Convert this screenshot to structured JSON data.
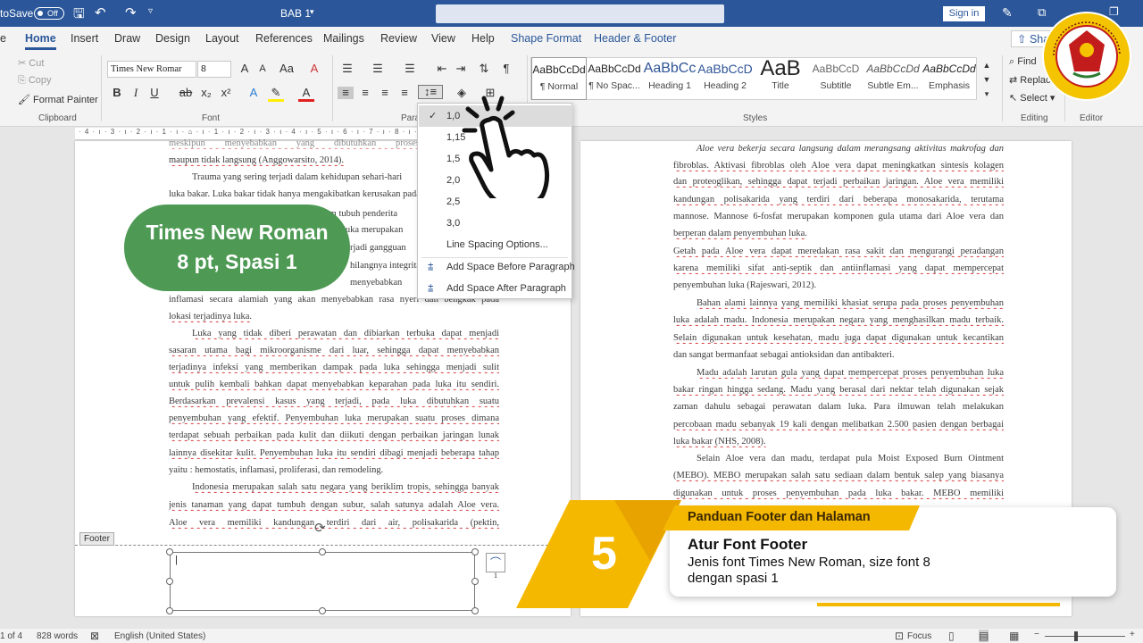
{
  "title_bar": {
    "autosave_label": "toSave",
    "autosave_state": "Off",
    "doc_name": "BAB 1",
    "signin": "Sign in"
  },
  "tabs": [
    "Home",
    "Insert",
    "Draw",
    "Design",
    "Layout",
    "References",
    "Mailings",
    "Review",
    "View",
    "Help",
    "Shape Format",
    "Header & Footer",
    "Shar"
  ],
  "ribbon": {
    "clipboard": {
      "cut": "Cut",
      "copy": "Copy",
      "format_painter": "Format Painter",
      "label": "Clipboard"
    },
    "font": {
      "name": "Times New Romar",
      "size": "8",
      "label": "Font"
    },
    "paragraph": {
      "label": "Para"
    },
    "styles": [
      {
        "preview": "AaBbCcDd",
        "name": "¶ Normal"
      },
      {
        "preview": "AaBbCcDd",
        "name": "¶ No Spac..."
      },
      {
        "preview": "AaBbCc",
        "name": "Heading 1"
      },
      {
        "preview": "AaBbCcD",
        "name": "Heading 2"
      },
      {
        "preview": "AaB",
        "name": "Title"
      },
      {
        "preview": "AaBbCcD",
        "name": "Subtitle"
      },
      {
        "preview": "AaBbCcDd",
        "name": "Subtle Em..."
      },
      {
        "preview": "AaBbCcDd",
        "name": "Emphasis"
      }
    ],
    "styles_label": "Styles",
    "editing": {
      "find": "Find",
      "replace": "Replace",
      "select": "Select",
      "label": "Editing"
    },
    "editor": {
      "label": "Editor"
    }
  },
  "line_spacing_menu": {
    "options": [
      "1,0",
      "1,15",
      "1,5",
      "2,0",
      "2,5",
      "3,0"
    ],
    "selected": "1,0",
    "more": "Line Spacing Options...",
    "add_before": "Add Space Before Paragraph",
    "add_after": "Add Space After Paragraph"
  },
  "left_page": {
    "lines": [
      "meskipun menyebabkan yang dibutuhkan proses luka adalah",
      "maupun tidak langsung (Anggowarsito, 2014).",
      "Trauma yang sering terjadi dalam kehidupan sehari-hari",
      "luka bakar. Luka bakar tidak hanya mengakibatkan kerusakan pada",
      "sistem tubuh penderita",
      "5). luka merupakan",
      "rjadi gangguan",
      "hilangnya integritas",
      "menyebabkan",
      "inflamasi secara alamiah yang akan menyebabkan rasa nyeri dan bengkak pada",
      "lokasi terjadinya luka.",
      "Luka yang tidak diberi perawatan dan dibiarkan terbuka dapat menjadi",
      "sasaran utama bagi mikroorganisme dari luar, sehingga dapat menyebabkan",
      "terjadinya infeksi yang memberikan dampak pada luka sehingga menjadi sulit",
      "untuk pulih kembali bahkan dapat menyebabkan keparahan pada luka itu sendiri.",
      "Berdasarkan prevalensi kasus yang terjadi, pada luka dibutuhkan suatu",
      "penyembuhan yang efektif. Penyembuhan luka merupakan suatu proses dimana",
      "terdapat sebuah perbaikan pada kulit dan diikuti dengan perbaikan jaringan lunak",
      "lainnya disekitar kulit. Penyembuhan luka itu sendiri dibagi menjadi beberapa tahap",
      "yaitu : hemostatis, inflamasi, proliferasi, dan remodeling.",
      "Indonesia merupakan salah satu negara yang beriklim tropis, sehingga banyak",
      "jenis tanaman yang dapat tumbuh dengan subur, salah satunya adalah Aloe vera.",
      "Aloe vera memiliki kandungan terdiri dari air, polisakarida (pektin,"
    ],
    "footer_label": "Footer",
    "footer_cursor": "|",
    "page_number": "1"
  },
  "right_page": {
    "lines": [
      "Aloe vera bekerja secara langsung dalam merangsang aktivitas makrofag dan",
      "fibroblas. Aktivasi fibroblas oleh Aloe vera dapat meningkatkan sintesis kolagen",
      "dan proteoglikan, sehingga dapat terjadi perbaikan jaringan. Aloe vera memiliki",
      "kandungan polisakarida yang terdiri dari beberapa monosakarida, terutama",
      "mannose. Mannose 6-fosfat merupakan komponen gula utama dari Aloe vera dan",
      "berperan dalam penyembuhan luka.",
      "Getah pada Aloe vera dapat meredakan rasa sakit dan mengurangi peradangan",
      "karena memiliki sifat anti-septik dan antiinflamasi yang dapat mempercepat",
      "penyembuhan luka (Rajeswari, 2012).",
      "Bahan alami lainnya yang memiliki khasiat serupa pada proses penyembuhan",
      "luka adalah madu. Indonesia merupakan negara yang menghasilkan madu terbaik.",
      "Selain digunakan untuk kesehatan, madu juga dapat digunakan untuk kecantikan",
      "dan sangat bermanfaat sebagai antioksidan dan antibakteri.",
      "Madu adalah larutan gula yang dapat mempercepat proses penyembuhan luka",
      "bakar ringan hingga sedang. Madu yang berasal dari nektar telah digunakan sejak",
      "zaman dahulu sebagai perawatan dalam luka. Para ilmuwan telah melakukan",
      "percobaan madu sebanyak 19 kali dengan melibatkan 2.500 pasien dengan berbagai",
      "luka bakar (NHS, 2008).",
      "Selain Aloe vera dan madu, terdapat pula Moist Exposed Burn Ointment",
      "(MEBO). MEBO merupakan salah satu sediaan dalam bentuk salep yang biasanya",
      "digunakan untuk proses penyembuhan pada luka bakar. MEBO memiliki"
    ]
  },
  "status_bar": {
    "page": "1 of 4",
    "words": "828 words",
    "language": "English (United States)",
    "focus": "Focus"
  },
  "bubble": {
    "line1": "Times New Roman",
    "line2": "8 pt, Spasi 1"
  },
  "banner": {
    "number": "5",
    "tag": "Panduan Footer dan Halaman",
    "title": "Atur Font Footer",
    "desc1": "Jenis font Times New Roman, size font 8",
    "desc2": "dengan spasi 1"
  },
  "colors": {
    "word_blue": "#2b579a",
    "green_bubble": "#4e9a55",
    "banner_yellow": "#f5b800",
    "banner_yellow_dark": "#e8a300"
  },
  "icons": [
    "cursor-hand-icon",
    "university-logo-icon",
    "checkmark-icon",
    "line-spacing-icon",
    "pen-icon"
  ]
}
